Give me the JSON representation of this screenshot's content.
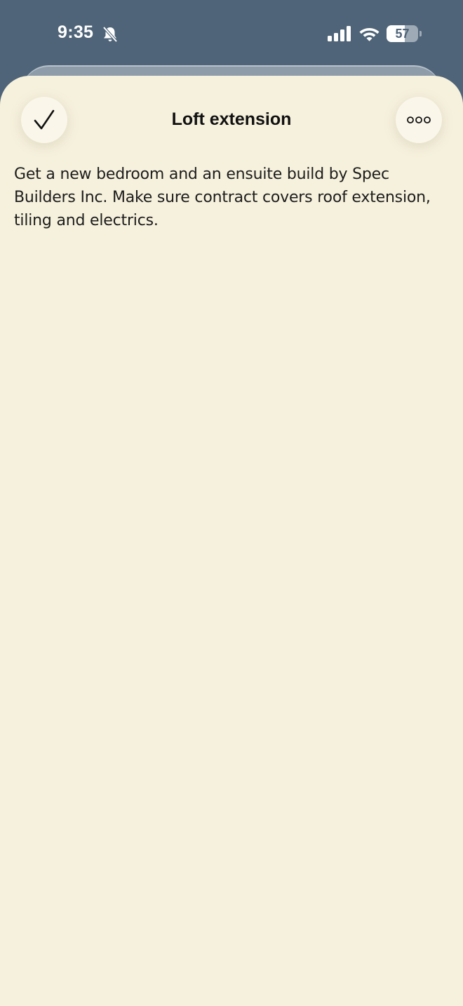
{
  "status_bar": {
    "time": "9:35",
    "battery_level": "57",
    "battery_fraction": 0.57,
    "icons": [
      "bell-slash-icon",
      "cellular-signal-icon",
      "wifi-icon",
      "battery-icon"
    ]
  },
  "sheet": {
    "title": "Loft extension",
    "done_icon": "checkmark-icon",
    "more_icon": "ellipsis-icon",
    "body": "Get a new bedroom and an ensuite build by Spec Builders Inc. Make sure contract covers roof extension, tiling and electrics."
  },
  "colors": {
    "status_background": "#4f6478",
    "sheet_background": "#f6f1dd",
    "button_background": "#faf6ea",
    "text": "#111111"
  }
}
